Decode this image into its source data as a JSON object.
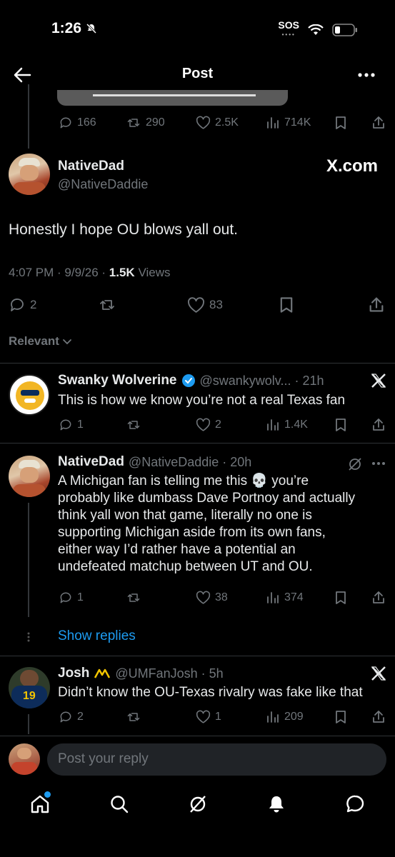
{
  "status_bar": {
    "time": "1:26",
    "sos": "SOS"
  },
  "nav": {
    "title": "Post"
  },
  "parent_stats": {
    "replies": "166",
    "reposts": "290",
    "likes": "2.5K",
    "views": "714K"
  },
  "main_post": {
    "name": "NativeDad",
    "handle": "@NativeDaddie",
    "badge": "X.com",
    "text": "Honestly I hope OU blows yall out.",
    "time": "4:07 PM · 9/9/26 · ",
    "views_count": "1.5K",
    "views_label": " Views",
    "replies": "2",
    "likes": "83"
  },
  "sort": {
    "label": "Relevant"
  },
  "replies": [
    {
      "name": "Swanky Wolverine",
      "handle": "@swankywolv... · 21h",
      "text": "This is how we know you’re not a real Texas fan",
      "replies": "1",
      "likes": "2",
      "views": "1.4K"
    },
    {
      "name": "NativeDad",
      "handle": "@NativeDaddie · 20h",
      "text_lines": [
        "A Michigan fan is telling me this 💀 you’re",
        "probably like dumbass Dave Portnoy and actually",
        "think yall won that game, literally no one is",
        "supporting Michigan aside from its own fans,",
        "either way I’d rather have a potential an",
        "undefeated matchup between UT and OU."
      ],
      "replies": "1",
      "likes": "38",
      "views": "374"
    },
    {
      "name": "Josh",
      "handle": "@UMFanJosh · 5h",
      "text": "Didn’t know the OU-Texas rivalry was fake like that",
      "replies": "2",
      "likes": "1",
      "views": "209"
    }
  ],
  "show_replies": "Show replies",
  "composer": {
    "placeholder": "Post your reply"
  },
  "colors": {
    "accent": "#1d9bf0",
    "background": "#000000",
    "muted": "#71767b"
  }
}
